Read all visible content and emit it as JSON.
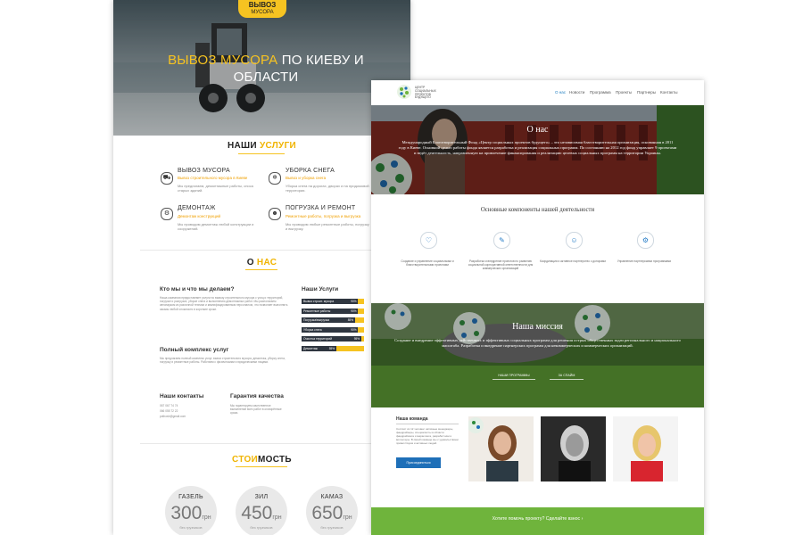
{
  "left_page": {
    "logo": {
      "line1": "ВЫВОЗ",
      "line2": "МУСОРА"
    },
    "hero": {
      "title_highlight": "ВЫВОЗ МУСОРА",
      "title_rest": " ПО КИЕВУ И ОБЛАСТИ"
    },
    "services_section": {
      "title_a": "НАШИ ",
      "title_b": "УСЛУГИ"
    },
    "services": [
      {
        "icon": "truck-icon",
        "title": "ВЫВОЗ МУСОРА",
        "subtitle": "Вывоз строительного мусора в Киеве",
        "desc": "Мы предлагаем, демонтажные работы, сноса старых зданий."
      },
      {
        "icon": "snowflake-icon",
        "title": "УБОРКА СНЕГА",
        "subtitle": "Вывоз и уборка снега",
        "desc": "Уборка снега на дорогах, дворах и на придомовой территории."
      },
      {
        "icon": "gears-icon",
        "title": "ДЕМОНТАЖ",
        "subtitle": "Демонтаж конструкций",
        "desc": "Мы проводим демонтаж любой конструкции и сооружений."
      },
      {
        "icon": "workers-icon",
        "title": "ПОГРУЗКА И РЕМОНТ",
        "subtitle": "Ремонтные работы, погрузка и выгрузка",
        "desc": "Мы проводим любые ремонтные работы, погрузку и выгрузку."
      }
    ],
    "about_section": {
      "title_a": "О ",
      "title_b": "НАС"
    },
    "about": {
      "h1": "Кто мы и что мы делаем?",
      "p1": "Наша компания предоставляет услуги по вывозу строительного мусора с улиц и территорий, погрузке и разгрузке, уборке снега и выполнению демонтажных работ. Мы располагаем автопарком из различной техники и квалифицированным персоналом, что позволяет выполнять заказы любой сложности в короткие сроки.",
      "h2": "Полный комплекс услуг",
      "p2": "Мы предлагаем полный комплекс услуг, вывоз строительного мусора, демонтаж, уборку снега, погрузку и ремонтные работы. Работаем с физическими и юридическими лицами.",
      "h3": "Наши контакты",
      "contacts": [
        "067 067 74 74",
        "066 055 72 22",
        "pothosh@gmail.com"
      ],
      "h4": "Гарантия качества",
      "p4": "Мы гарантируем качественное выполнение всех работ в оговорённые сроки.",
      "skills_title": "Наши Услуги",
      "skills": [
        {
          "label": "Вывоз строит. мусора",
          "pct": 90
        },
        {
          "label": "Ремонтные работы",
          "pct": 90
        },
        {
          "label": "Погрузка/выгрузка",
          "pct": 85
        },
        {
          "label": "Уборка снега",
          "pct": 90
        },
        {
          "label": "Очистка территорий",
          "pct": 95
        },
        {
          "label": "Демонтаж",
          "pct": 55
        }
      ]
    },
    "price_section": {
      "title_a": "СТОИ",
      "title_b": "МОСТЬ"
    },
    "prices": [
      {
        "name": "ГАЗЕЛЬ",
        "value": "300",
        "unit": "грн",
        "sub": "без грузчиков"
      },
      {
        "name": "ЗИЛ",
        "value": "450",
        "unit": "грн",
        "sub": "без грузчиков"
      },
      {
        "name": "КАМАЗ",
        "value": "650",
        "unit": "грн",
        "sub": "без грузчиков"
      }
    ]
  },
  "right_page": {
    "logo_text": "ЦЕНТР СОЦИАЛЬНЫХ ПРОЕКТОВ БУДУЩЕГО",
    "nav": [
      "О нас",
      "Новости",
      "Программа",
      "Проекты",
      "Партнеры",
      "Контакты"
    ],
    "hero": {
      "title": "О нас",
      "text": "Международный Благотворительный Фонд «Центр социальных проектов будущего» – это независимая благотворительная организация, основанная в 2011 году в Киеве. Основной целью работы фонда является разработка и реализация социальных программ. По состоянию на 2012 год фонд управляет 9 проектами и ведёт деятельность, направленную на привлечение финансирования и реализацию целевых социальных программ на территории Украины."
    },
    "components": {
      "title": "Основные компоненты нашей деятельности",
      "items": [
        {
          "icon": "heart-icon",
          "text": "Создание и управление социальными и благотворительными проектами"
        },
        {
          "icon": "pencil-icon",
          "text": "Разработка и внедрение проектов по развитию социальной корпоративной ответственности для коммерческих организаций"
        },
        {
          "icon": "people-icon",
          "text": "Координация и активное партнерство с донорами"
        },
        {
          "icon": "gears-icon",
          "text": "Управление партнерскими программами"
        }
      ]
    },
    "mission": {
      "title": "Наша миссия",
      "text": "Создание и внедрение эффективных действенных и эффективных социальных программ для решения острых общественных задач регионального и национального масштаба. Разработка и внедрение партнерских программ для некоммерческих и коммерческих организаций.",
      "btn1": "НАШИ ПРОГРАММЫ",
      "btn2": "ЗА СПАЙМ"
    },
    "team": {
      "title": "Наша команда",
      "text": "Состоит из 12 человек: активные менеджеры, фандрайзеры, специалисты в области фандрайзинга и маркетинга, разработчики и волонтеры. В своей команде мы с удовольствием приветствуем и активных людей.",
      "button": "Присоединиться"
    },
    "footer": {
      "text": "Хотите помочь проекту? Сделайте взнос",
      "arrow": "›"
    }
  }
}
